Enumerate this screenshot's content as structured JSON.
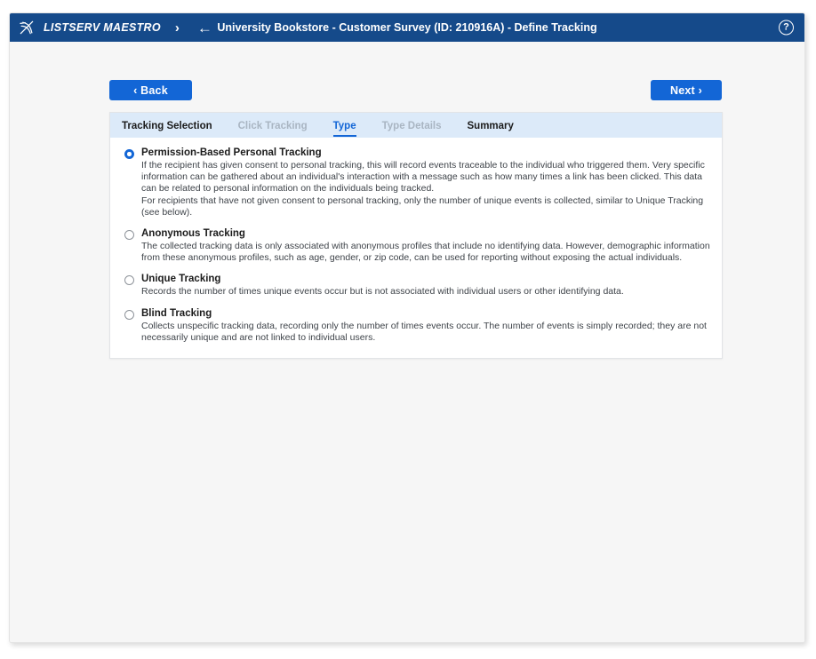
{
  "titlebar": {
    "brand": "LISTSERV MAESTRO",
    "logo_icon": "maestro-logo-icon",
    "forward_chevron": "›",
    "back_arrow": "←",
    "title": "University Bookstore - Customer Survey (ID: 210916A) - Define Tracking",
    "help_glyph": "?",
    "background_color": "#154a8a"
  },
  "toolbar": {
    "back_label": "‹ Back",
    "next_label": "Next ›",
    "button_color": "#1366d6"
  },
  "tabs": [
    {
      "label": "Tracking Selection",
      "state": "enabled"
    },
    {
      "label": "Click Tracking",
      "state": "disabled"
    },
    {
      "label": "Type",
      "state": "current"
    },
    {
      "label": "Type Details",
      "state": "disabled"
    },
    {
      "label": "Summary",
      "state": "enabled"
    }
  ],
  "tracking_options": [
    {
      "label": "Permission-Based Personal Tracking",
      "selected": true,
      "paragraphs": [
        "If the recipient has given consent to personal tracking, this will record events traceable to the individual who triggered them. Very specific information can be gathered about an individual's interaction with a message such as how many times a link has been clicked. This data can be related to personal information on the individuals being tracked.",
        "For recipients that have not given consent to personal tracking, only the number of unique events is collected, similar to Unique Tracking (see below)."
      ]
    },
    {
      "label": "Anonymous Tracking",
      "selected": false,
      "paragraphs": [
        "The collected tracking data is only associated with anonymous profiles that include no identifying data. However, demographic information from these anonymous profiles, such as age, gender, or zip code, can be used for reporting without exposing the actual individuals."
      ]
    },
    {
      "label": "Unique Tracking",
      "selected": false,
      "paragraphs": [
        "Records the number of times unique events occur but is not associated with individual users or other identifying data."
      ]
    },
    {
      "label": "Blind Tracking",
      "selected": false,
      "paragraphs": [
        "Collects unspecific tracking data, recording only the number of times events occur. The number of events is simply recorded; they are not necessarily unique and are not linked to individual users."
      ]
    }
  ]
}
